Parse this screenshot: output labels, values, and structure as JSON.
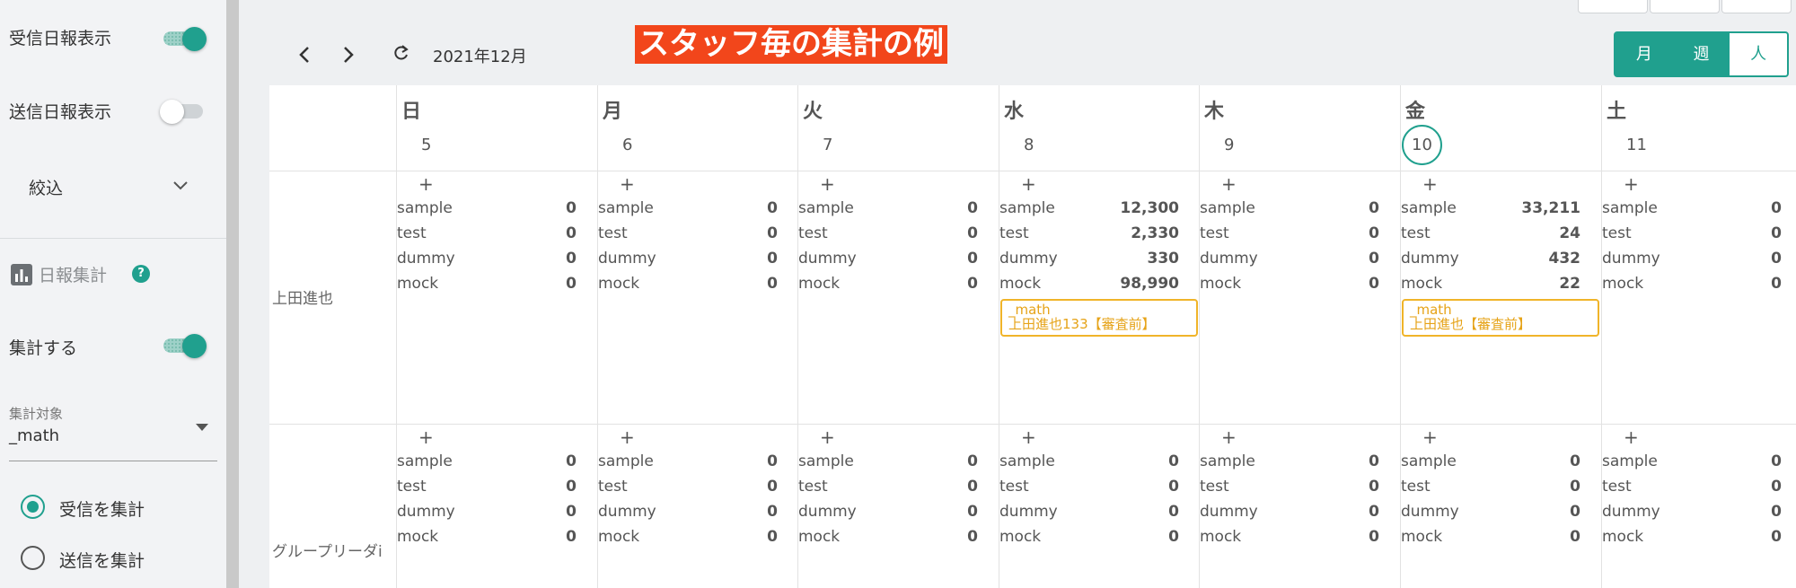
{
  "sidebar": {
    "show_received": "受信日報表示",
    "show_sent": "送信日報表示",
    "filter": "絞込",
    "summary_title": "日報集計",
    "help": "?",
    "aggregate": "集計する",
    "target_label": "集計対象",
    "target_value": "_math",
    "radio_received": "受信を集計",
    "radio_sent": "送信を集計"
  },
  "toolbar": {
    "month": "2021年12月",
    "banner": "スタッフ毎の集計の例",
    "views": [
      "月",
      "週",
      "人"
    ]
  },
  "days": [
    {
      "dow": "日",
      "num": "5"
    },
    {
      "dow": "月",
      "num": "6"
    },
    {
      "dow": "火",
      "num": "7"
    },
    {
      "dow": "水",
      "num": "8"
    },
    {
      "dow": "木",
      "num": "9"
    },
    {
      "dow": "金",
      "num": "10"
    },
    {
      "dow": "土",
      "num": "11"
    }
  ],
  "metric_names": [
    "sample",
    "test",
    "dummy",
    "mock"
  ],
  "rows": [
    {
      "staff": "上田進也",
      "values": [
        [
          "0",
          "0",
          "0",
          "0"
        ],
        [
          "0",
          "0",
          "0",
          "0"
        ],
        [
          "0",
          "0",
          "0",
          "0"
        ],
        [
          "12,300",
          "2,330",
          "330",
          "98,990"
        ],
        [
          "0",
          "0",
          "0",
          "0"
        ],
        [
          "33,211",
          "24",
          "432",
          "22"
        ],
        [
          "0",
          "0",
          "0",
          "0"
        ]
      ],
      "events": [
        {
          "day": 3,
          "line1": "_math",
          "line2": "上田進也133【審査前】"
        },
        {
          "day": 5,
          "line1": "_math",
          "line2": "上田進也【審査前】"
        }
      ]
    },
    {
      "staff": "グループリーダi",
      "values": [
        [
          "0",
          "0",
          "0",
          "0"
        ],
        [
          "0",
          "0",
          "0",
          "0"
        ],
        [
          "0",
          "0",
          "0",
          "0"
        ],
        [
          "0",
          "0",
          "0",
          "0"
        ],
        [
          "0",
          "0",
          "0",
          "0"
        ],
        [
          "0",
          "0",
          "0",
          "0"
        ],
        [
          "0",
          "0",
          "0",
          "0"
        ]
      ],
      "events": []
    }
  ],
  "colors": {
    "accent": "#20a08e",
    "banner": "#f2461b",
    "event": "#f0b429"
  }
}
